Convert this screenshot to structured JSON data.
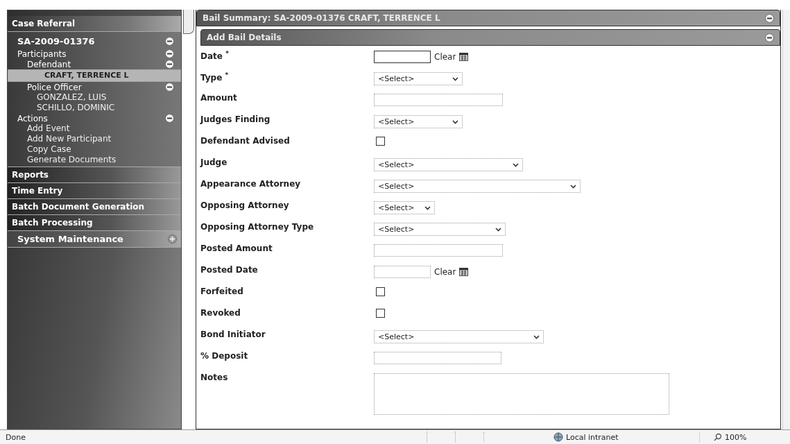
{
  "sidebar": {
    "sections": [
      {
        "kind": "header",
        "label": "Case Referral"
      },
      {
        "kind": "tree",
        "label": "SA-2009-01376",
        "expanded": true,
        "children": [
          {
            "label": "Participants",
            "expanded": true,
            "children": [
              {
                "label": "Defendant",
                "expanded": true,
                "children": [
                  {
                    "label": "CRAFT, TERRENCE L",
                    "selected": true
                  }
                ]
              },
              {
                "label": "Police Officer",
                "expanded": true,
                "children": [
                  {
                    "label": "GONZALEZ, LUIS",
                    "selected": false
                  },
                  {
                    "label": "SCHILLO, DOMINIC",
                    "selected": false
                  }
                ]
              }
            ]
          },
          {
            "label": "Actions",
            "expanded": true,
            "children": [
              {
                "label": "Add Event",
                "selected": false
              },
              {
                "label": "Add New Participant",
                "selected": false
              },
              {
                "label": "Copy Case",
                "selected": false
              },
              {
                "label": "Generate Documents",
                "selected": false
              }
            ]
          }
        ]
      },
      {
        "kind": "link",
        "label": "Reports"
      },
      {
        "kind": "link",
        "label": "Time Entry"
      },
      {
        "kind": "link",
        "label": "Batch Document Generation"
      },
      {
        "kind": "link",
        "label": "Batch Processing"
      },
      {
        "kind": "group",
        "label": "System Maintenance",
        "expanded": false
      }
    ]
  },
  "panel": {
    "title": "Bail Summary: SA-2009-01376 CRAFT, TERRENCE L",
    "expanded": true,
    "section": {
      "title": "Add Bail Details",
      "expanded": true,
      "fields": [
        {
          "kind": "date",
          "label": "Date",
          "required_mark": "*",
          "clear": "Clear"
        },
        {
          "kind": "select",
          "label": "Type",
          "required_mark": "*",
          "value": "<Select>"
        },
        {
          "kind": "text",
          "label": "Amount"
        },
        {
          "kind": "select",
          "label": "Judges Finding",
          "value": "<Select>"
        },
        {
          "kind": "checkbox",
          "label": "Defendant Advised",
          "checked": false
        },
        {
          "kind": "select",
          "label": "Judge",
          "value": "<Select>"
        },
        {
          "kind": "select",
          "label": "Appearance Attorney",
          "value": "<Select>"
        },
        {
          "kind": "select",
          "label": "Opposing Attorney",
          "value": "<Select>"
        },
        {
          "kind": "select",
          "label": "Opposing Attorney Type",
          "value": "<Select>"
        },
        {
          "kind": "text",
          "label": "Posted Amount"
        },
        {
          "kind": "date",
          "label": "Posted Date",
          "clear": "Clear"
        },
        {
          "kind": "checkbox",
          "label": "Forfeited",
          "checked": false
        },
        {
          "kind": "checkbox",
          "label": "Revoked",
          "checked": false
        },
        {
          "kind": "select",
          "label": "Bond Initiator",
          "value": "<Select>"
        },
        {
          "kind": "text",
          "label": "% Deposit"
        },
        {
          "kind": "textarea",
          "label": "Notes"
        }
      ]
    }
  },
  "status_bar": {
    "status": "Done",
    "zone": "Local intranet",
    "zoom": "100%"
  }
}
